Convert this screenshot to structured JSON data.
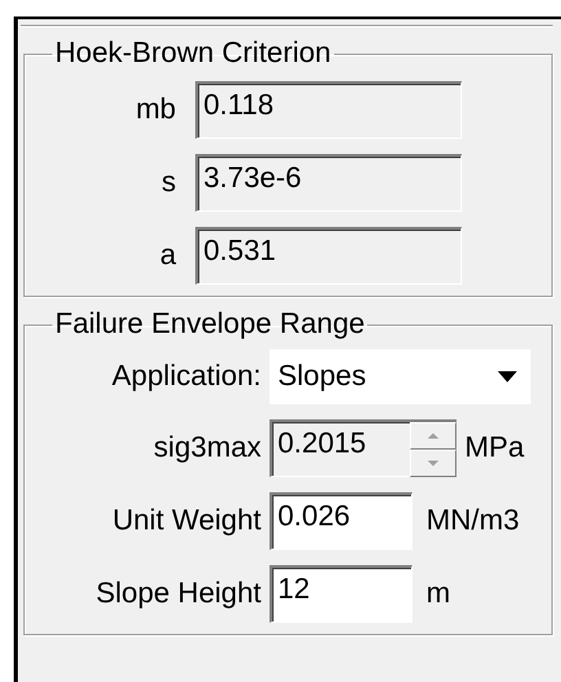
{
  "hoek_brown": {
    "title": "Hoek-Brown Criterion",
    "fields": [
      {
        "label": "mb",
        "value": "0.118",
        "disabled": true
      },
      {
        "label": "s",
        "value": "3.73e-6",
        "disabled": true
      },
      {
        "label": "a",
        "value": "0.531",
        "disabled": true
      }
    ]
  },
  "failure_envelope": {
    "title": "Failure Envelope Range",
    "application": {
      "label": "Application:",
      "value": "Slopes"
    },
    "fields": [
      {
        "kind": "spin",
        "label": "sig3max",
        "value": "0.2015",
        "unit": "MPa",
        "disabled": true
      },
      {
        "kind": "text",
        "label": "Unit Weight",
        "value": "0.026",
        "unit": "MN/m3",
        "disabled": false
      },
      {
        "kind": "text",
        "label": "Slope Height",
        "value": "12",
        "unit": "m",
        "disabled": false
      }
    ]
  }
}
